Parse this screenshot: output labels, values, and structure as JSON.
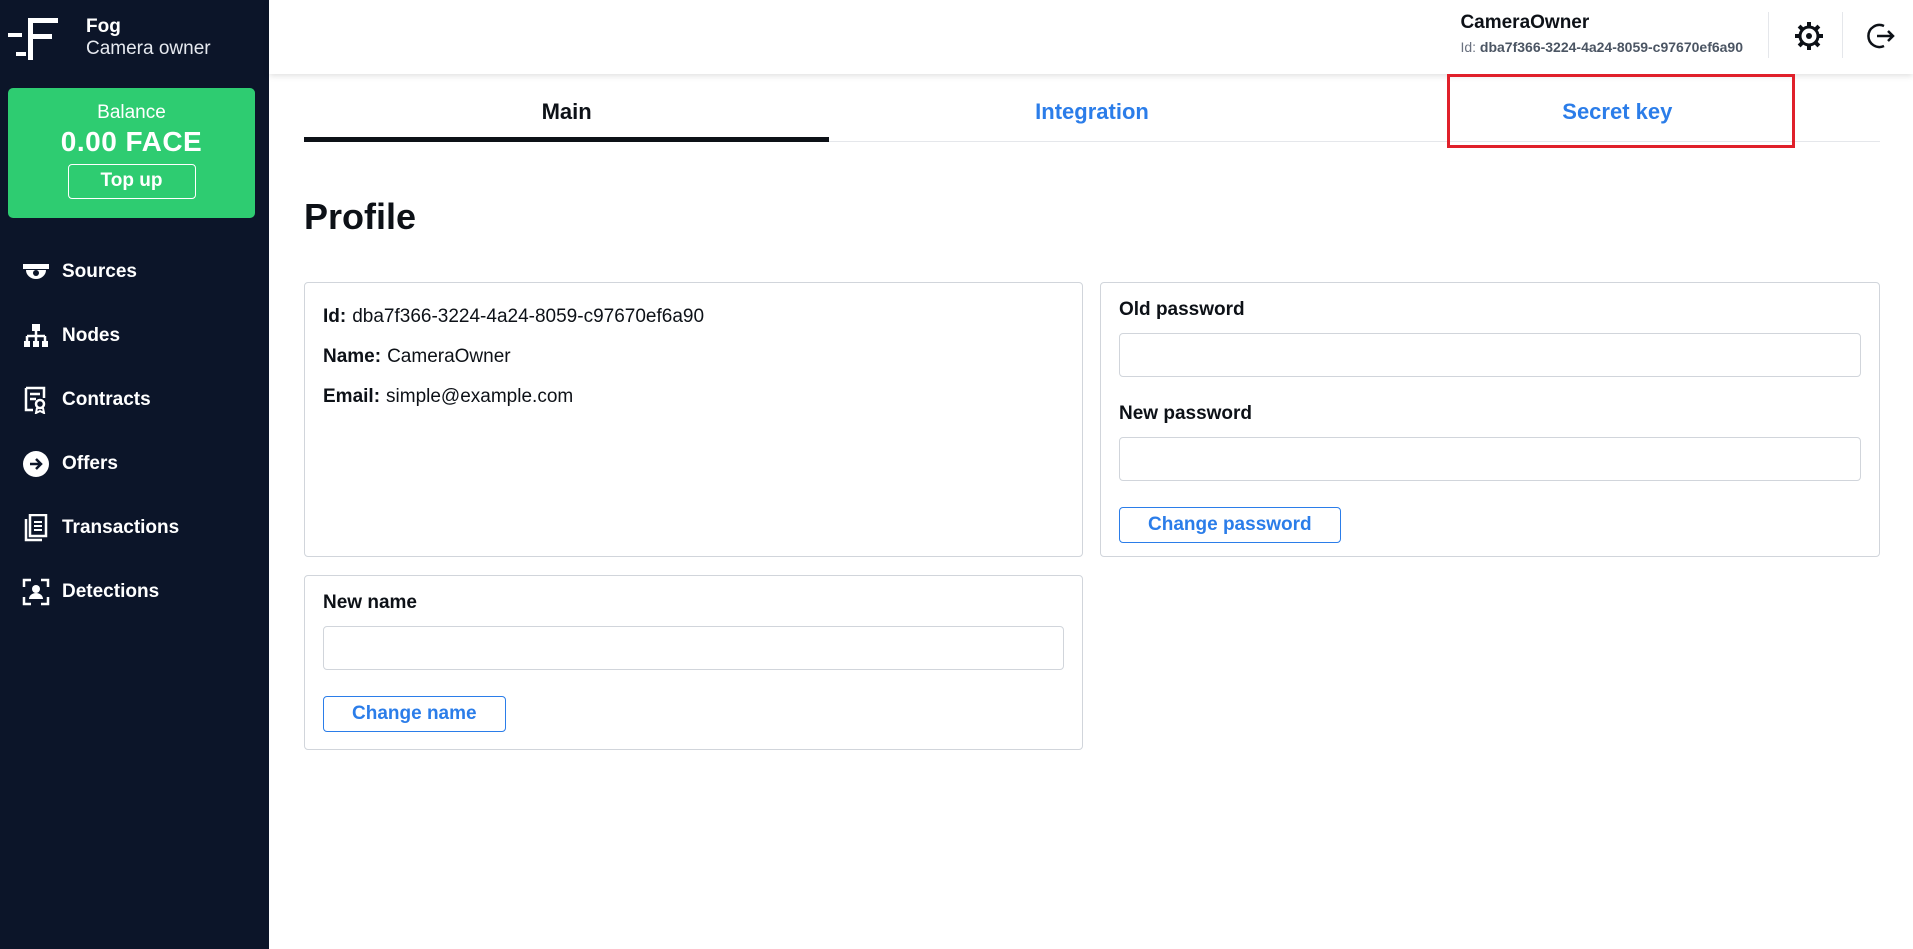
{
  "brand": {
    "name": "Fog",
    "role": "Camera owner"
  },
  "balance": {
    "label": "Balance",
    "value": "0.00 FACE",
    "topup_label": "Top up"
  },
  "nav": [
    {
      "label": "Sources",
      "icon": "camera-icon"
    },
    {
      "label": "Nodes",
      "icon": "network-icon"
    },
    {
      "label": "Contracts",
      "icon": "contract-icon"
    },
    {
      "label": "Offers",
      "icon": "arrow-right-circle-icon"
    },
    {
      "label": "Transactions",
      "icon": "documents-icon"
    },
    {
      "label": "Detections",
      "icon": "face-scan-icon"
    }
  ],
  "header": {
    "user_name": "CameraOwner",
    "id_label": "Id:",
    "id_value": "dba7f366-3224-4a24-8059-c97670ef6a90",
    "settings_icon": "gear-icon",
    "logout_icon": "logout-icon"
  },
  "tabs": [
    {
      "label": "Main",
      "active": true
    },
    {
      "label": "Integration",
      "active": false
    },
    {
      "label": "Secret key",
      "active": false
    }
  ],
  "page": {
    "title": "Profile"
  },
  "profile": {
    "id_label": "Id:",
    "id_value": "dba7f366-3224-4a24-8059-c97670ef6a90",
    "name_label": "Name:",
    "name_value": "CameraOwner",
    "email_label": "Email:",
    "email_value": "simple@example.com"
  },
  "password_form": {
    "old_label": "Old password",
    "old_value": "",
    "new_label": "New password",
    "new_value": "",
    "submit_label": "Change password"
  },
  "name_form": {
    "label": "New name",
    "value": "",
    "submit_label": "Change name"
  },
  "colors": {
    "sidebar": "#0c1529",
    "balance": "#2ecc71",
    "accent": "#2b7de9",
    "highlight": "#e0202a"
  }
}
